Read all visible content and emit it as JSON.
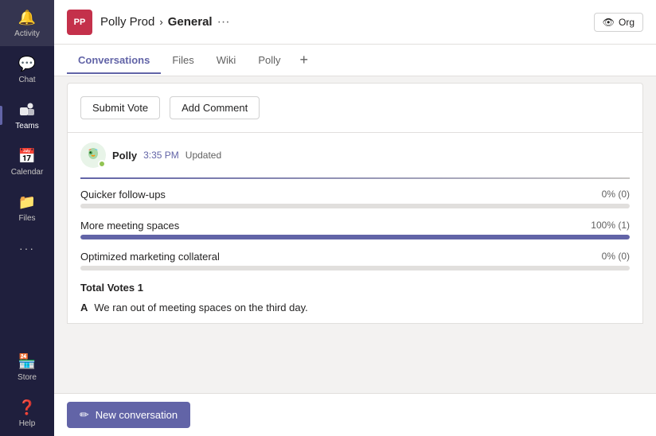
{
  "sidebar": {
    "items": [
      {
        "id": "activity",
        "label": "Activity",
        "icon": "🔔",
        "active": false
      },
      {
        "id": "chat",
        "label": "Chat",
        "icon": "💬",
        "active": false
      },
      {
        "id": "teams",
        "label": "Teams",
        "icon": "👥",
        "active": true
      },
      {
        "id": "calendar",
        "label": "Calendar",
        "icon": "📅",
        "active": false
      },
      {
        "id": "files",
        "label": "Files",
        "icon": "📁",
        "active": false
      },
      {
        "id": "more",
        "label": "...",
        "icon": "···",
        "active": false
      },
      {
        "id": "store",
        "label": "Store",
        "icon": "🏪",
        "active": false
      },
      {
        "id": "help",
        "label": "Help",
        "icon": "❓",
        "active": false
      }
    ]
  },
  "header": {
    "team_avatar_text": "PP",
    "team_name": "Polly Prod",
    "chevron": "›",
    "channel_name": "General",
    "dots": "···",
    "org_button": "Org",
    "org_icon": "👁"
  },
  "tabs": [
    {
      "id": "conversations",
      "label": "Conversations",
      "active": true
    },
    {
      "id": "files",
      "label": "Files",
      "active": false
    },
    {
      "id": "wiki",
      "label": "Wiki",
      "active": false
    },
    {
      "id": "polly",
      "label": "Polly",
      "active": false
    }
  ],
  "tab_add_label": "+",
  "poll": {
    "submit_vote_label": "Submit Vote",
    "add_comment_label": "Add Comment",
    "sender": "Polly",
    "time": "3:35 PM",
    "status": "Updated",
    "options": [
      {
        "label": "Quicker follow-ups",
        "percent": "0% (0)",
        "fill": 0
      },
      {
        "label": "More meeting spaces",
        "percent": "100% (1)",
        "fill": 100
      },
      {
        "label": "Optimized marketing collateral",
        "percent": "0% (0)",
        "fill": 0
      }
    ],
    "total_votes_label": "Total Votes",
    "total_votes_value": "1",
    "comment_letter": "A",
    "comment_text": "We ran out of meeting spaces on the third day."
  },
  "footer": {
    "new_conversation_label": "New conversation",
    "new_conversation_icon": "✏"
  }
}
